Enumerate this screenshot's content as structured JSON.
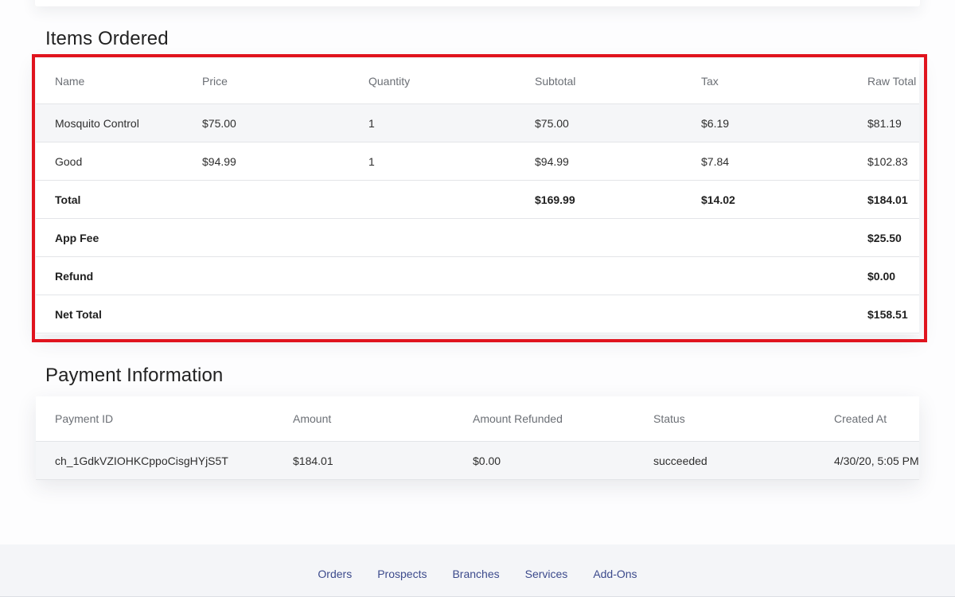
{
  "items_section": {
    "title": "Items Ordered",
    "columns": [
      "Name",
      "Price",
      "Quantity",
      "Subtotal",
      "Tax",
      "Raw Total"
    ],
    "rows": [
      [
        "Mosquito Control",
        "$75.00",
        "1",
        "$75.00",
        "$6.19",
        "$81.19"
      ],
      [
        "Good",
        "$94.99",
        "1",
        "$94.99",
        "$7.84",
        "$102.83"
      ]
    ],
    "total": {
      "label": "Total",
      "subtotal": "$169.99",
      "tax": "$14.02",
      "raw_total": "$184.01"
    },
    "app_fee": {
      "label": "App Fee",
      "value": "$25.50"
    },
    "refund": {
      "label": "Refund",
      "value": "$0.00"
    },
    "net_total": {
      "label": "Net Total",
      "value": "$158.51"
    }
  },
  "payment_section": {
    "title": "Payment Information",
    "columns": [
      "Payment ID",
      "Amount",
      "Amount Refunded",
      "Status",
      "Created At"
    ],
    "rows": [
      [
        "ch_1GdkVZIOHKCppoCisgHYjS5T",
        "$184.01",
        "$0.00",
        "succeeded",
        "4/30/20, 5:05 PM"
      ]
    ]
  },
  "footer": {
    "links": [
      "Orders",
      "Prospects",
      "Branches",
      "Services",
      "Add-Ons"
    ]
  },
  "colors": {
    "highlight_border": "#e0141e",
    "footer_link": "#3c4a8c",
    "row_shade": "#f5f6f8"
  }
}
